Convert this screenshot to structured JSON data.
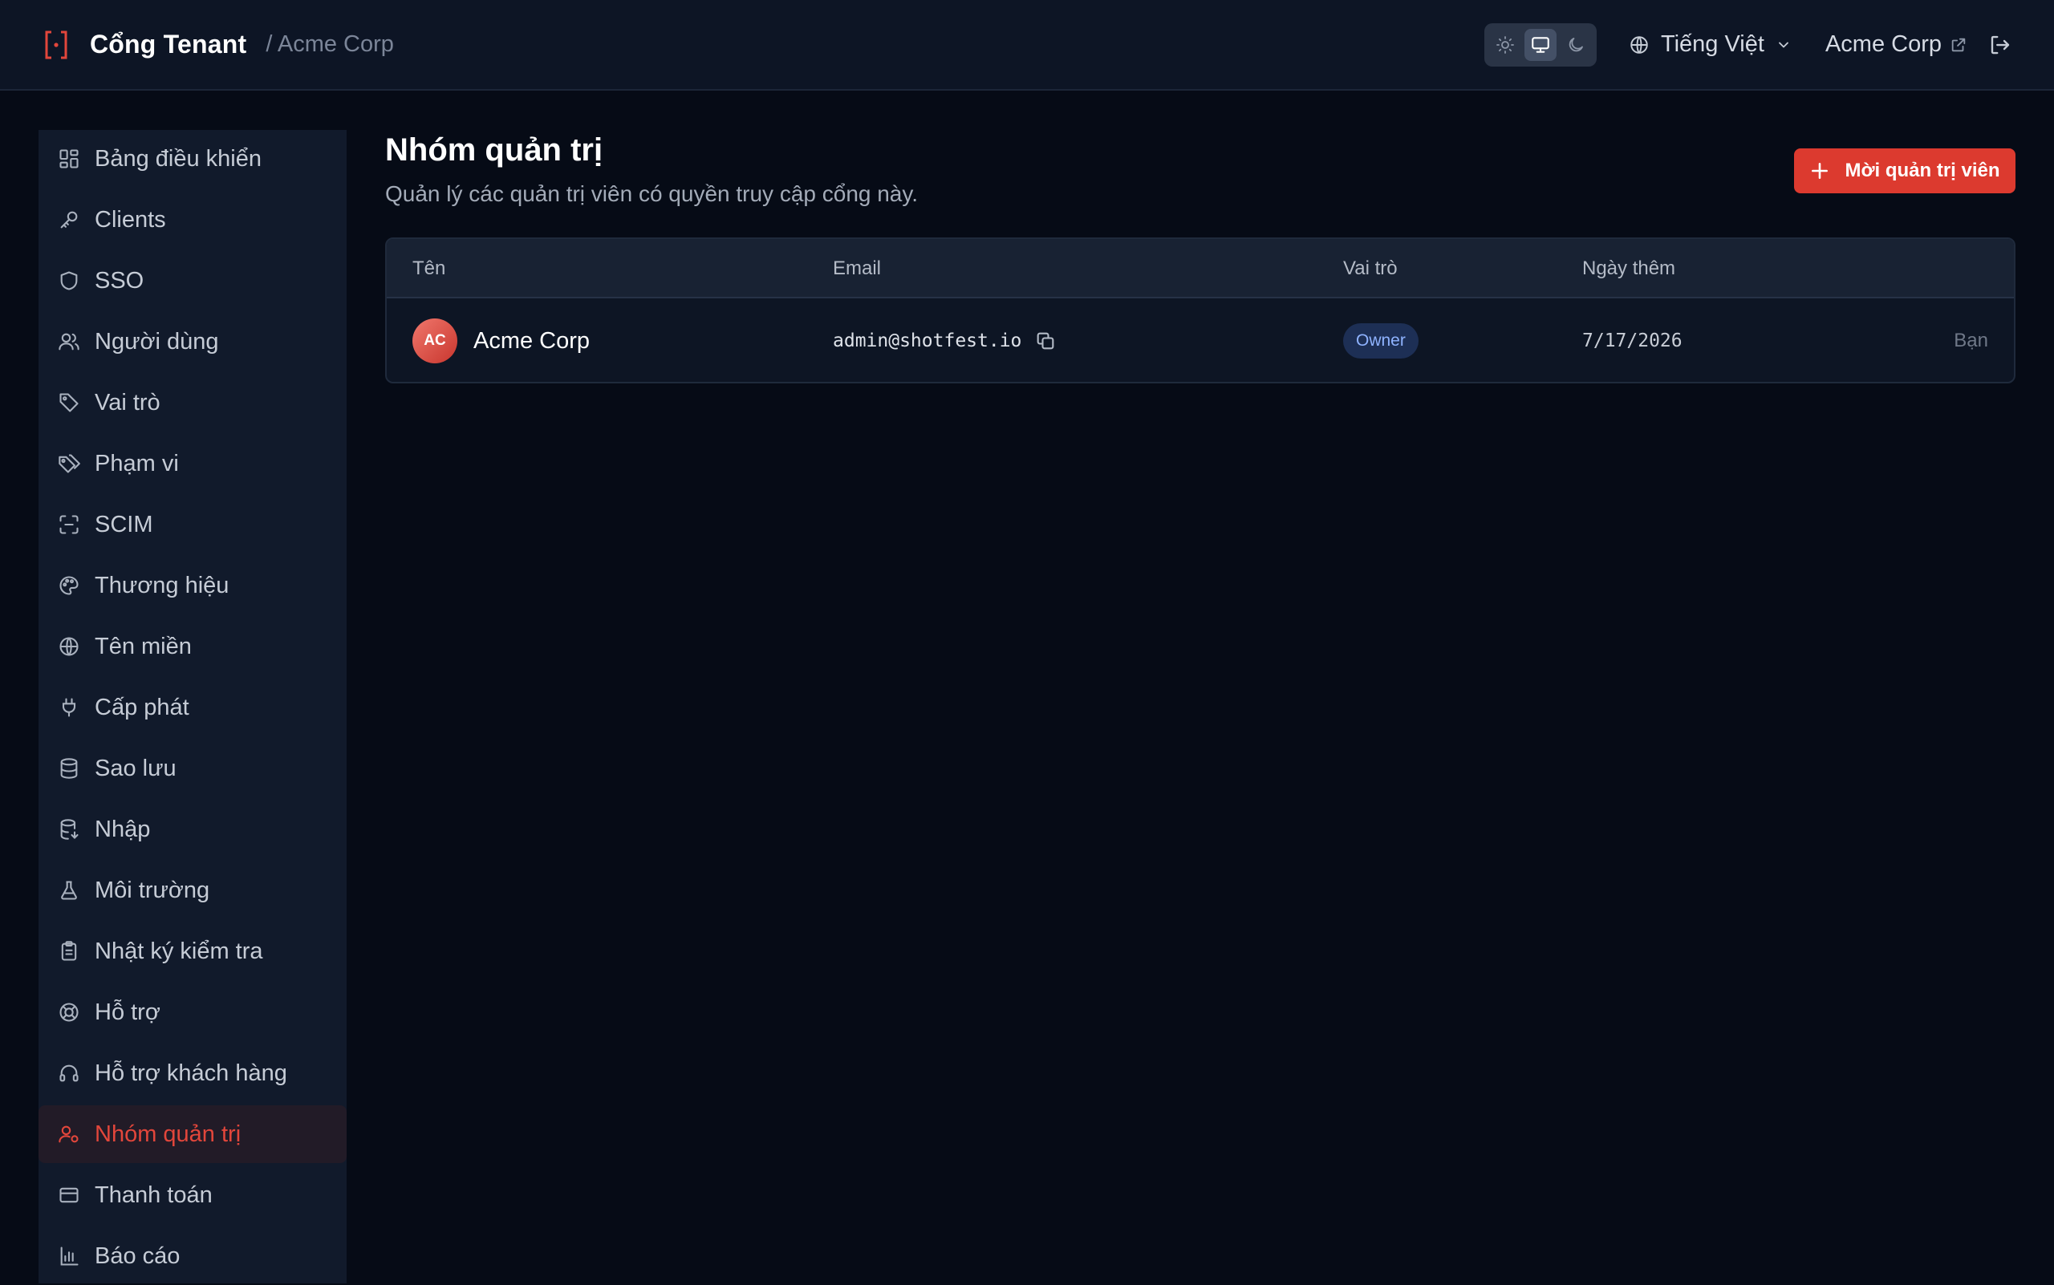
{
  "header": {
    "brand": "Cổng Tenant",
    "breadcrumb": "/ Acme Corp",
    "language": "Tiếng Việt",
    "tenant_link": "Acme Corp",
    "theme_modes": [
      "light",
      "system",
      "dark"
    ],
    "active_theme": "system",
    "accent_color": "#e2463b"
  },
  "sidebar": {
    "items": [
      {
        "label": "Bảng điều khiển",
        "icon": "dashboard-icon"
      },
      {
        "label": "Clients",
        "icon": "key-icon"
      },
      {
        "label": "SSO",
        "icon": "shield-icon"
      },
      {
        "label": "Người dùng",
        "icon": "users-icon"
      },
      {
        "label": "Vai trò",
        "icon": "tag-icon"
      },
      {
        "label": "Phạm vi",
        "icon": "tags-icon"
      },
      {
        "label": "SCIM",
        "icon": "scan-icon"
      },
      {
        "label": "Thương hiệu",
        "icon": "palette-icon"
      },
      {
        "label": "Tên miền",
        "icon": "globe-icon"
      },
      {
        "label": "Cấp phát",
        "icon": "plug-icon"
      },
      {
        "label": "Sao lưu",
        "icon": "database-icon"
      },
      {
        "label": "Nhập",
        "icon": "database-import-icon"
      },
      {
        "label": "Môi trường",
        "icon": "flask-icon"
      },
      {
        "label": "Nhật ký kiểm tra",
        "icon": "clipboard-icon"
      },
      {
        "label": "Hỗ trợ",
        "icon": "lifebuoy-icon"
      },
      {
        "label": "Hỗ trợ khách hàng",
        "icon": "headset-icon"
      },
      {
        "label": "Nhóm quản trị",
        "icon": "user-cog-icon"
      },
      {
        "label": "Thanh toán",
        "icon": "credit-card-icon"
      },
      {
        "label": "Báo cáo",
        "icon": "bar-chart-icon"
      }
    ],
    "active_index": 16
  },
  "main": {
    "title": "Nhóm quản trị",
    "subtitle": "Quản lý các quản trị viên có quyền truy cập cổng này.",
    "invite_label": "Mời quản trị viên",
    "table": {
      "headers": {
        "name": "Tên",
        "email": "Email",
        "role": "Vai trò",
        "added": "Ngày thêm"
      },
      "rows": [
        {
          "initials": "AC",
          "name": "Acme Corp",
          "email": "admin@shotfest.io",
          "role": "Owner",
          "added": "7/17/2026",
          "note": "Bạn"
        }
      ]
    }
  }
}
